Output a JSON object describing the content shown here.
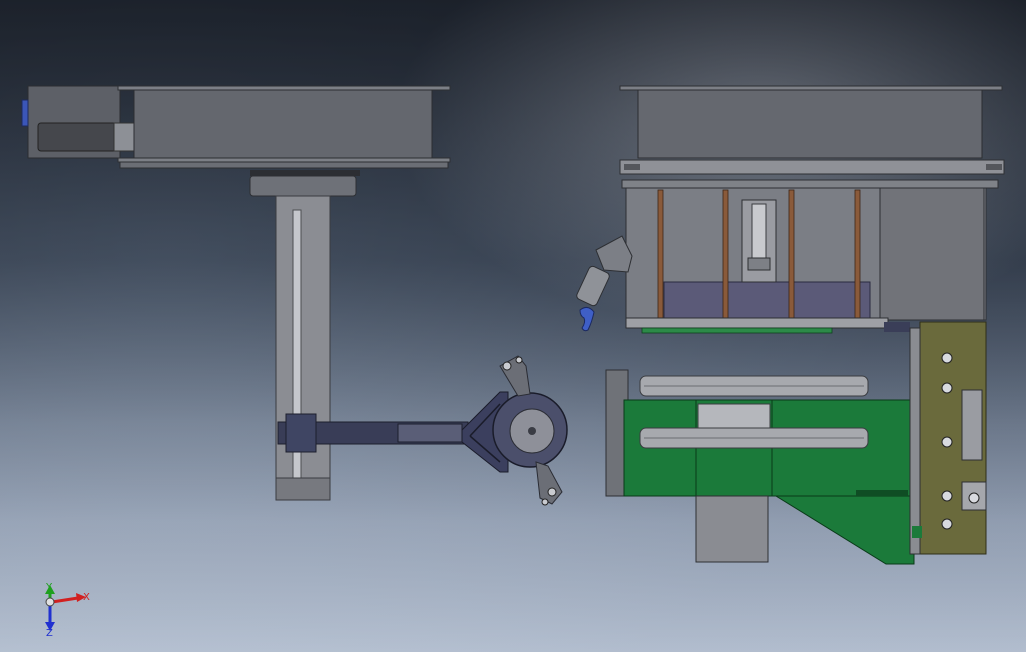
{
  "triad": {
    "x_label": "X",
    "y_label": "Y",
    "z_label": "Z",
    "x_color": "#d22020",
    "y_color": "#1ea01e",
    "z_color": "#2030d0"
  },
  "colors": {
    "steel_dark": "#5f6168",
    "steel": "#6d7077",
    "steel_light": "#8a8c92",
    "green_block": "#1b7a3a",
    "olive_plate": "#6a6a3c",
    "arm_dark": "#3a3f59",
    "purple_plate": "#5b5a78",
    "copper_rod": "#8a5a3a"
  }
}
